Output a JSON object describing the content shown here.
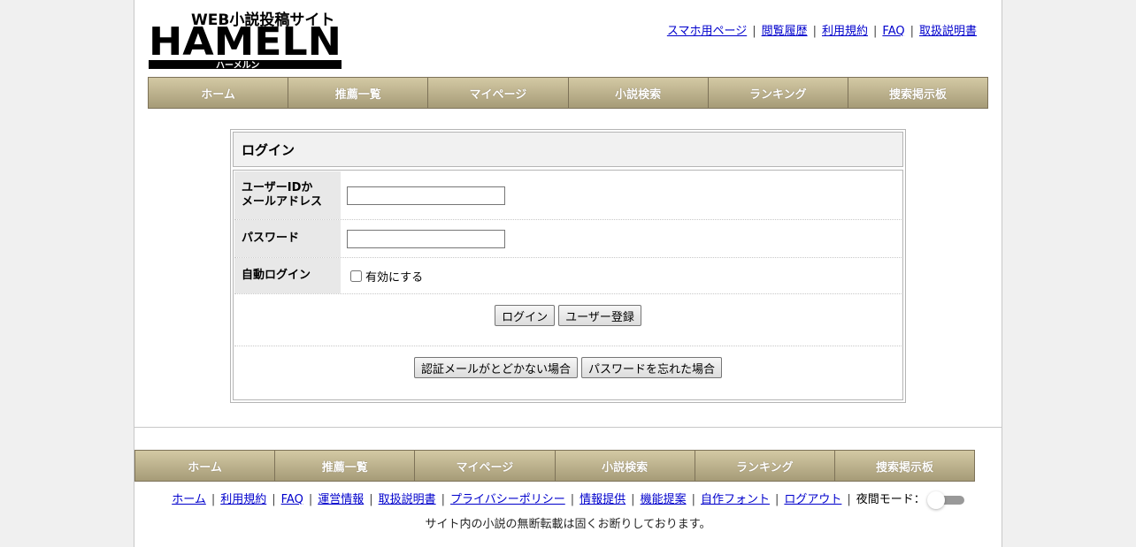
{
  "logo": {
    "top_text": "WEB小説投稿サイト",
    "main_text": "HAMELN",
    "sub_text": "ハーメルン"
  },
  "top_links": [
    "スマホ用ページ",
    "閲覧履歴",
    "利用規約",
    "FAQ",
    "取扱説明書"
  ],
  "nav": [
    "ホーム",
    "推薦一覧",
    "マイページ",
    "小説検索",
    "ランキング",
    "捜索掲示板"
  ],
  "login": {
    "title": "ログイン",
    "user_label_1": "ユーザーIDか",
    "user_label_2": "メールアドレス",
    "user_value": "",
    "password_label": "パスワード",
    "password_value": "",
    "auto_login_label": "自動ログイン",
    "auto_login_checkbox": "有効にする",
    "login_button": "ログイン",
    "register_button": "ユーザー登録",
    "no_mail_button": "認証メールがとどかない場合",
    "forgot_password_button": "パスワードを忘れた場合"
  },
  "footer": {
    "links": [
      "ホーム",
      "利用規約",
      "FAQ",
      "運営情報",
      "取扱説明書",
      "プライバシーポリシー",
      "情報提供",
      "機能提案",
      "自作フォント",
      "ログアウト"
    ],
    "night_mode_label": "夜間モード：",
    "copyright": "サイト内の小説の無断転載は固くお断りしております。"
  },
  "colors": {
    "nav_gradient_top": "#d3c9a4",
    "nav_gradient_bottom": "#a69b77",
    "link": "#0000cc"
  }
}
